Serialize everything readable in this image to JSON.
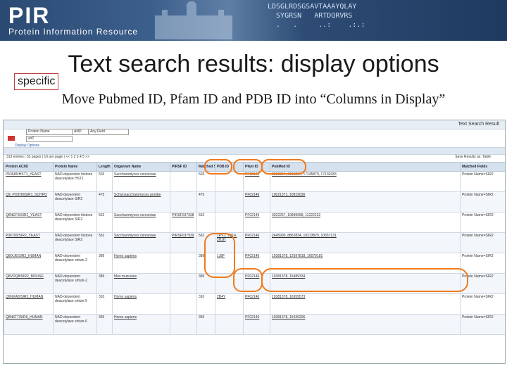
{
  "banner": {
    "logo": "PIR",
    "subtitle": "Protein Information Resource",
    "seq_lines": "LDSGLRDSGSAVTAAAYQLAY\n  SYGRSN   ARTDQRVRS\n  .   .     ..:    .:.:"
  },
  "slide": {
    "title": "Text search results: display options",
    "specific_label": "specific",
    "instruction": "Move Pubmed ID, Pfam ID and PDB ID into “Columns in Display”"
  },
  "screenshot": {
    "header_right": "Text Search Result",
    "search_field": "Protein Name",
    "and_op": "AND",
    "any_field": "Any Field",
    "query": "sir2",
    "display_options": "Display Options",
    "pager": "313 entries | 33 pages | 10 per page | << 1 2 3 4 5 >>",
    "save_results": "Save Results as: Table",
    "columns": [
      "Protein AC/ID",
      "Protein Name",
      "Length",
      "Organism Name",
      "PIRSF ID",
      "Matched Seq",
      "PDB ID",
      "Pfam ID",
      "PubMed ID",
      "Matched Fields"
    ],
    "rows": [
      {
        "id": "P53685/HST1_YEAST",
        "name": "NAD-dependent histone deacetylase HST1",
        "len": "503",
        "org": "Saccharomyces cerevisiae",
        "pirsf": "",
        "seq": "503",
        "pdb": "",
        "pfam": "PF02146",
        "pubmed": "8530367, 9009207, 17245879, 17130283",
        "fields": "Protein Name=SIR2"
      },
      {
        "id": "Q9_PO3H9/SIR1_SCHPO",
        "name": "NAD-dependent deacetylase SIR2",
        "len": "475",
        "org": "Schizosaccharomyces pombe",
        "pirsf": "",
        "seq": "475",
        "pdb": "",
        "pfam": "PF02146",
        "pubmed": "10021371, 10819036",
        "fields": "Protein Name=SIR2"
      },
      {
        "id": "Q8NEP3/SIR2_YEAST",
        "name": "NAD-dependent histone deacetylase SIR2",
        "len": "562",
        "org": "Saccharomyces cerevisiae",
        "pirsf": "PIRSF037938",
        "seq": "562",
        "pdb": "",
        "pfam": "PF02146",
        "pubmed": "3022267, 10889998, 11222232",
        "fields": "Protein Name=SIR2"
      },
      {
        "id": "P06700/SIR2_YEAST",
        "name": "NAD-dependent histone deacetylase SIR2",
        "len": "562",
        "org": "Saccharomyces cerevisiae",
        "pirsf": "PIRSF037939",
        "seq": "562",
        "pdb": "1PVJ, 1Q14, 2HJH",
        "pfam": "PF02146",
        "pubmed": "2445990, 8862834, 10213829, 10657131",
        "fields": "Protein Name=SIR2"
      },
      {
        "id": "Q8IXJ6/SIR2_HUMAN",
        "name": "NAD-dependent deacetylase sirtuin-2",
        "len": "389",
        "org": "Homo sapiens",
        "pirsf": "",
        "seq": "389",
        "pdb": "1J8F",
        "pfam": "PF02146",
        "pubmed": "10381378, 12697818, 16079181",
        "fields": "Protein Name=SIR2"
      },
      {
        "id": "Q8VDQ8/SIR2_MOUSE",
        "name": "NAD-dependent deacetylase sirtuin-2",
        "len": "389",
        "org": "Mus musculus",
        "pirsf": "",
        "seq": "389",
        "pdb": "",
        "pfam": "PF02146",
        "pubmed": "10381378, 15489334",
        "fields": "Protein Name=SIR2"
      },
      {
        "id": "Q9NXA8/SIR5_HUMAN",
        "name": "NAD-dependent deacetylase sirtuin-5",
        "len": "310",
        "org": "Homo sapiens",
        "pirsf": "",
        "seq": "310",
        "pdb": "2B4Y",
        "pfam": "PF02146",
        "pubmed": "10381378, 16959573",
        "fields": "Protein Name=SIR2"
      },
      {
        "id": "Q8N6T7/SIR6_HUMAN",
        "name": "NAD-dependent deacetylase sirtuin-6",
        "len": "355",
        "org": "Homo sapiens",
        "pirsf": "",
        "seq": "355",
        "pdb": "",
        "pfam": "PF02146",
        "pubmed": "10381378, 16439206",
        "fields": "Protein Name=SIR2"
      }
    ]
  }
}
